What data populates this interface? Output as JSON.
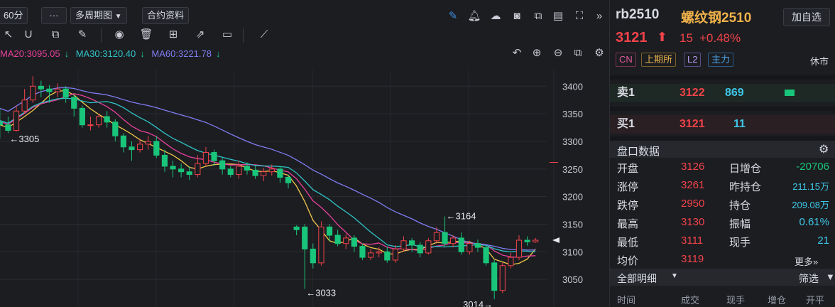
{
  "toolbar": {
    "interval": "60分",
    "more": "···",
    "multi_period": "多周期图",
    "contract_info": "合约资料"
  },
  "ma": [
    {
      "label": "MA20:3095.05",
      "arrow": "↓",
      "color": "#e6409a"
    },
    {
      "label": "MA30:3120.40",
      "arrow": "↓",
      "color": "#2fc4c7"
    },
    {
      "label": "MA60:3221.78",
      "arrow": "↓",
      "color": "#7f7df2"
    }
  ],
  "chart_data": {
    "type": "candlestick",
    "ylim": [
      3000,
      3430
    ],
    "y_ticks": [
      "3400",
      "3350",
      "3300",
      "3250",
      "3200",
      "3150",
      "3100",
      "3050"
    ],
    "annotations": {
      "high1": "←3305",
      "low1": "←3033",
      "high2": "←3164",
      "low2": "3014→"
    },
    "candles": [
      [
        3335,
        3330,
        3360,
        3305
      ],
      [
        3330,
        3320,
        3345,
        3315
      ],
      [
        3320,
        3355,
        3365,
        3318
      ],
      [
        3355,
        3375,
        3395,
        3350
      ],
      [
        3375,
        3400,
        3418,
        3370
      ],
      [
        3400,
        3395,
        3410,
        3380
      ],
      [
        3395,
        3390,
        3402,
        3370
      ],
      [
        3390,
        3395,
        3405,
        3380
      ],
      [
        3395,
        3380,
        3400,
        3370
      ],
      [
        3380,
        3360,
        3385,
        3345
      ],
      [
        3360,
        3330,
        3365,
        3325
      ],
      [
        3330,
        3330,
        3345,
        3320
      ],
      [
        3330,
        3345,
        3350,
        3325
      ],
      [
        3345,
        3335,
        3355,
        3325
      ],
      [
        3335,
        3310,
        3340,
        3300
      ],
      [
        3310,
        3290,
        3315,
        3280
      ],
      [
        3290,
        3285,
        3300,
        3265
      ],
      [
        3285,
        3295,
        3305,
        3280
      ],
      [
        3295,
        3300,
        3310,
        3285
      ],
      [
        3300,
        3275,
        3310,
        3270
      ],
      [
        3275,
        3255,
        3285,
        3245
      ],
      [
        3255,
        3250,
        3265,
        3235
      ],
      [
        3250,
        3245,
        3260,
        3235
      ],
      [
        3245,
        3240,
        3255,
        3230
      ],
      [
        3240,
        3260,
        3275,
        3235
      ],
      [
        3260,
        3280,
        3290,
        3255
      ],
      [
        3280,
        3265,
        3285,
        3255
      ],
      [
        3265,
        3250,
        3270,
        3240
      ],
      [
        3250,
        3240,
        3255,
        3235
      ],
      [
        3240,
        3255,
        3265,
        3232
      ],
      [
        3255,
        3248,
        3262,
        3240
      ],
      [
        3248,
        3238,
        3256,
        3232
      ],
      [
        3238,
        3245,
        3252,
        3228
      ],
      [
        3245,
        3250,
        3258,
        3238
      ],
      [
        3250,
        3235,
        3255,
        3225
      ],
      [
        3235,
        3225,
        3240,
        3215
      ],
      [
        3145,
        3140,
        3148,
        3130
      ],
      [
        3145,
        3105,
        3150,
        3033
      ],
      [
        3105,
        3080,
        3115,
        3070
      ],
      [
        3080,
        3145,
        3155,
        3075
      ],
      [
        3145,
        3130,
        3150,
        3120
      ],
      [
        3130,
        3115,
        3140,
        3110
      ],
      [
        3115,
        3125,
        3132,
        3105
      ],
      [
        3125,
        3110,
        3130,
        3100
      ],
      [
        3110,
        3090,
        3115,
        3085
      ],
      [
        3090,
        3098,
        3105,
        3085
      ],
      [
        3098,
        3100,
        3108,
        3090
      ],
      [
        3100,
        3085,
        3110,
        3080
      ],
      [
        3085,
        3105,
        3112,
        3080
      ],
      [
        3105,
        3120,
        3128,
        3100
      ],
      [
        3120,
        3112,
        3125,
        3100
      ],
      [
        3112,
        3098,
        3118,
        3090
      ],
      [
        3098,
        3120,
        3125,
        3095
      ],
      [
        3120,
        3135,
        3145,
        3115
      ],
      [
        3135,
        3115,
        3164,
        3110
      ],
      [
        3115,
        3125,
        3130,
        3108
      ],
      [
        3125,
        3100,
        3135,
        3095
      ],
      [
        3100,
        3115,
        3120,
        3095
      ],
      [
        3115,
        3108,
        3122,
        3100
      ],
      [
        3108,
        3080,
        3112,
        3075
      ],
      [
        3080,
        3030,
        3085,
        3014
      ],
      [
        3030,
        3075,
        3080,
        3025
      ],
      [
        3075,
        3090,
        3098,
        3070
      ],
      [
        3090,
        3121,
        3130,
        3085
      ],
      [
        3121,
        3118,
        3128,
        3111
      ],
      [
        3118,
        3121,
        3125,
        3116
      ]
    ]
  },
  "panel": {
    "symbol": "rb2510",
    "name": "螺纹钢2510",
    "watch_button": "加自选",
    "price": "3121",
    "change": "15",
    "change_pct": "+0.48%",
    "tags": [
      "CN",
      "上期所",
      "L2",
      "主力"
    ],
    "session": "休市",
    "ask": {
      "label": "卖1",
      "price": "3122",
      "vol": "869"
    },
    "bid": {
      "label": "买1",
      "price": "3121",
      "vol": "11"
    },
    "section_title": "盘口数据",
    "stats_left": [
      {
        "label": "开盘",
        "value": "3126"
      },
      {
        "label": "涨停",
        "value": "3261"
      },
      {
        "label": "跌停",
        "value": "2950"
      },
      {
        "label": "最高",
        "value": "3130"
      },
      {
        "label": "最低",
        "value": "3111"
      },
      {
        "label": "均价",
        "value": "3119"
      }
    ],
    "stats_right": [
      {
        "label": "日增仓",
        "value": "-20706"
      },
      {
        "label": "昨持仓",
        "value": "211.15万"
      },
      {
        "label": "持仓",
        "value": "209.08万"
      },
      {
        "label": "振幅",
        "value": "0.61%"
      },
      {
        "label": "现手",
        "value": "21"
      }
    ],
    "more": "更多»",
    "detail_title": "全部明细",
    "filter": "筛选",
    "columns": [
      "时间",
      "成交",
      "现手",
      "增仓",
      "开平"
    ]
  }
}
